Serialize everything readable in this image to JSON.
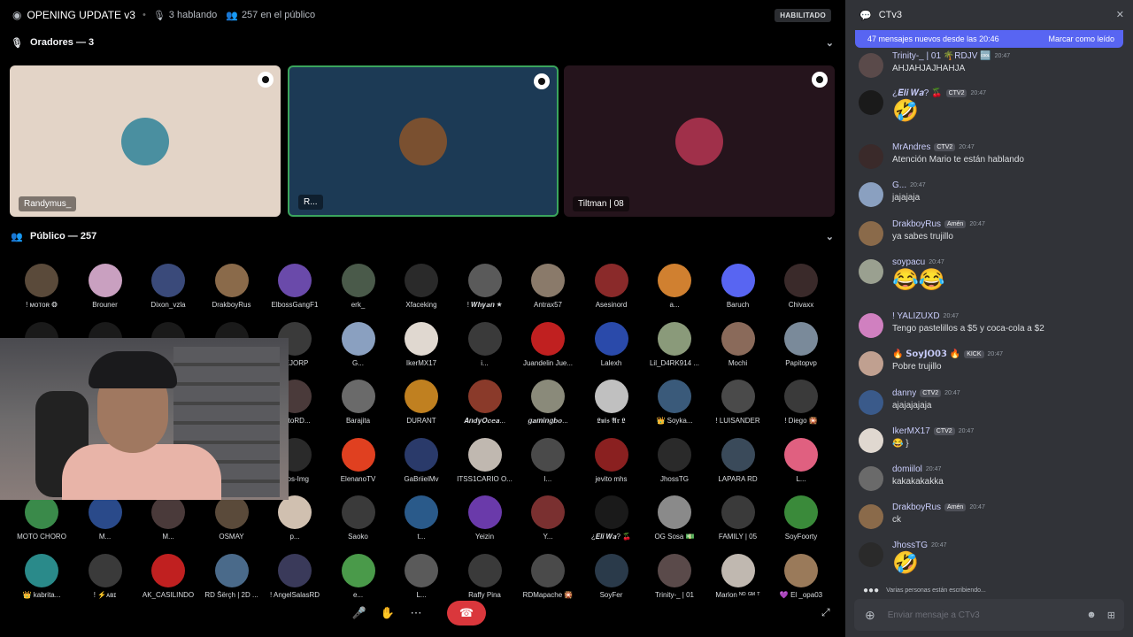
{
  "topbar": {
    "title": "OPENING UPDATE v3",
    "speaking": "3 hablando",
    "audience": "257 en el público",
    "badge": "HABILITADO"
  },
  "speakers_section": {
    "label": "Oradores — 3"
  },
  "speakers": [
    {
      "label": "Randymus_",
      "color": "#e3d4c7",
      "avatar": "#4a8fa0",
      "selected": false
    },
    {
      "label": "R...",
      "color": "#1c3a55",
      "avatar": "#7a5030",
      "selected": true
    },
    {
      "label": "Tiltman | 08",
      "color": "#25141c",
      "avatar": "#a0304a",
      "selected": false
    }
  ],
  "audience_section": {
    "label": "Público — 257"
  },
  "audience": [
    {
      "name": "! ᴍᴏᴛᴏʀ ❂",
      "color": "#5a4a3a"
    },
    {
      "name": "Brouner",
      "color": "#c9a0c0"
    },
    {
      "name": "Dixon_vzla",
      "color": "#3a4a7a"
    },
    {
      "name": "DrakboyRus",
      "color": "#8a6a4a"
    },
    {
      "name": "ElbossGangF1",
      "color": "#6a4aaa"
    },
    {
      "name": "erk_",
      "color": "#4a5a4a"
    },
    {
      "name": "Xfaceking",
      "color": "#2a2a2a"
    },
    {
      "name": "! 𝑾𝒉𝒚𝒂𝒏 ★",
      "color": "#5a5a5a"
    },
    {
      "name": "Antrax57",
      "color": "#8a7a6a"
    },
    {
      "name": "Asesinord",
      "color": "#8a2a2a"
    },
    {
      "name": "a...",
      "color": "#d08030"
    },
    {
      "name": "Baruch",
      "color": "#5865f2"
    },
    {
      "name": "Chivaxx",
      "color": "#3a2a2a"
    },
    {
      "name": "",
      "color": "#1a1a1a"
    },
    {
      "name": "",
      "color": "#1a1a1a"
    },
    {
      "name": "",
      "color": "#1a1a1a"
    },
    {
      "name": "",
      "color": "#1a1a1a"
    },
    {
      "name": "JEJORP",
      "color": "#3a3a3a"
    },
    {
      "name": "G...",
      "color": "#8aa0c0"
    },
    {
      "name": "IkerMX17",
      "color": "#e0d8d0"
    },
    {
      "name": "i...",
      "color": "#3a3a3a"
    },
    {
      "name": "Juandelin Jue...",
      "color": "#c02020"
    },
    {
      "name": "Lalexh",
      "color": "#2a4aaa"
    },
    {
      "name": "Lil_D4RK914 ...",
      "color": "#8a9a7a"
    },
    {
      "name": "Mochi",
      "color": "#8a6a5a"
    },
    {
      "name": "Papitopvp",
      "color": "#7a8a9a"
    },
    {
      "name": "",
      "color": "#1a1a1a"
    },
    {
      "name": "",
      "color": "#1a1a1a"
    },
    {
      "name": "",
      "color": "#1a1a1a"
    },
    {
      "name": "",
      "color": "#1a1a1a"
    },
    {
      "name": "RatoRD...",
      "color": "#4a3a3a"
    },
    {
      "name": "Barajita",
      "color": "#6a6a6a"
    },
    {
      "name": "DURANT",
      "color": "#c08020"
    },
    {
      "name": "𝑨𝒏𝒅𝒚𝑶𝒄𝒆𝒂...",
      "color": "#8a3a2a"
    },
    {
      "name": "𝒈𝒂𝒎𝒊𝒏𝒈𝒃𝒐...",
      "color": "#8a8a7a"
    },
    {
      "name": "𝕷𝖚𝖎𝖘 𝕬𝖗 𝕷",
      "color": "#c0c0c0"
    },
    {
      "name": "👑 Soyka...",
      "color": "#3a5a7a"
    },
    {
      "name": "! LUISANDER",
      "color": "#4a4a4a"
    },
    {
      "name": "! Diego 🎇",
      "color": "#3a3a3a"
    },
    {
      "name": "",
      "color": "#1a1a1a"
    },
    {
      "name": "",
      "color": "#1a1a1a"
    },
    {
      "name": "",
      "color": "#1a1a1a"
    },
    {
      "name": "",
      "color": "#1a1a1a"
    },
    {
      "name": "Rlos-Img",
      "color": "#2a2a2a"
    },
    {
      "name": "ElenanoTV",
      "color": "#e04020"
    },
    {
      "name": "GaBriielMv",
      "color": "#2a3a6a"
    },
    {
      "name": "ITSS1CARIO O...",
      "color": "#c0b8b0"
    },
    {
      "name": "l...",
      "color": "#4a4a4a"
    },
    {
      "name": "jevito mhs",
      "color": "#8a2020"
    },
    {
      "name": "JhossTG",
      "color": "#2a2a2a"
    },
    {
      "name": "LAPARA RD",
      "color": "#3a4a5a"
    },
    {
      "name": "L...",
      "color": "#e06080"
    },
    {
      "name": "MOTO CHORO",
      "color": "#3a8a4a"
    },
    {
      "name": "M...",
      "color": "#2a4a8a"
    },
    {
      "name": "M...",
      "color": "#4a3a3a"
    },
    {
      "name": "OSMAY",
      "color": "#5a4a3a"
    },
    {
      "name": "p...",
      "color": "#d0c0b0"
    },
    {
      "name": "Saoko",
      "color": "#3a3a3a"
    },
    {
      "name": "t...",
      "color": "#2a5a8a"
    },
    {
      "name": "Yeizin",
      "color": "#6a3aaa"
    },
    {
      "name": "Y...",
      "color": "#7a3030"
    },
    {
      "name": "¿𝑬𝒍𝒊 𝑾𝒂? 🍒",
      "color": "#1a1a1a"
    },
    {
      "name": "OG Sosa 💵",
      "color": "#8a8a8a"
    },
    {
      "name": "FAMILY | 05",
      "color": "#3a3a3a"
    },
    {
      "name": "SoyFoorty",
      "color": "#3a8a3a"
    },
    {
      "name": "👑 kabrita...",
      "color": "#2a8a8a"
    },
    {
      "name": "! ⚡ᴀʙɪ",
      "color": "#3a3a3a"
    },
    {
      "name": "AK_CASILINDO",
      "color": "#c02020"
    },
    {
      "name": "RD Šërçh | 2D ...",
      "color": "#4a6a8a"
    },
    {
      "name": "! AngelSalasRD",
      "color": "#3a3a5a"
    },
    {
      "name": "e...",
      "color": "#4a9a4a"
    },
    {
      "name": "L...",
      "color": "#5a5a5a"
    },
    {
      "name": "Raffy Pina",
      "color": "#3a3a3a"
    },
    {
      "name": "RDMapache 🎇",
      "color": "#4a4a4a"
    },
    {
      "name": "SoyFer",
      "color": "#2a3a4a"
    },
    {
      "name": "Trinity-_ | 01",
      "color": "#5a4a4a"
    },
    {
      "name": "Marlon ᴺᴼ ᴳᴹ ᵀ",
      "color": "#c0b8b0"
    },
    {
      "name": "💜 El _opa03",
      "color": "#9a7a5a"
    }
  ],
  "chat": {
    "channel": "CTv3",
    "banner_text": "47 mensajes nuevos desde las 20:46",
    "banner_action": "Marcar como leído",
    "messages": [
      {
        "name": "Trinity-_ | 01 🌴RDJV 🆒",
        "time": "20:47",
        "body": "AHJAHJAJHAHJA",
        "emoji": "",
        "avatar": "#5a4a4a"
      },
      {
        "name": "¿𝑬𝒍𝒊 𝑾𝒂? 🍒",
        "tag": "CTV2",
        "time": "20:47",
        "body": "",
        "emoji": "🤣",
        "avatar": "#1a1a1a"
      },
      {
        "name": "MrAndres",
        "tag": "CTV2",
        "time": "20:47",
        "body": "Atención Mario te están hablando",
        "emoji": "",
        "avatar": "#3a2a2a"
      },
      {
        "name": "G...",
        "time": "20:47",
        "body": "jajajaja",
        "emoji": "",
        "avatar": "#8aa0c0"
      },
      {
        "name": "DrakboyRus",
        "tag": "Amén",
        "time": "20:47",
        "body": "ya sabes trujillo",
        "emoji": "",
        "avatar": "#8a6a4a"
      },
      {
        "name": "soypacu",
        "time": "20:47",
        "body": "",
        "emoji": "😂😂",
        "avatar": "#9aa090"
      },
      {
        "name": "! YALIZUXD",
        "time": "20:47",
        "body": "Tengo pastelillos a $5 y coca-cola a $2",
        "emoji": "",
        "avatar": "#d080c0"
      },
      {
        "name": "🔥 𝗦𝗼𝘆𝗝𝗢𝟬𝟯 🔥",
        "tag": "KICK",
        "time": "20:47",
        "body": "Pobre trujillo",
        "emoji": "",
        "avatar": "#c0a090"
      },
      {
        "name": "danny",
        "tag": "CTV2",
        "time": "20:47",
        "body": "ajajajajaja",
        "emoji": "",
        "avatar": "#3a5a8a"
      },
      {
        "name": "IkerMX17",
        "tag": "CTV2",
        "time": "20:47",
        "body": "😂 }",
        "emoji": "",
        "avatar": "#e0d8d0"
      },
      {
        "name": "domiilol",
        "time": "20:47",
        "body": "kakakakakka",
        "emoji": "",
        "avatar": "#6a6a6a"
      },
      {
        "name": "DrakboyRus",
        "tag": "Amén",
        "time": "20:47",
        "body": "ck",
        "emoji": "",
        "avatar": "#8a6a4a"
      },
      {
        "name": "JhossTG",
        "time": "20:47",
        "body": "",
        "emoji": "🤣",
        "avatar": "#2a2a2a"
      }
    ],
    "typing": "Varias personas están escribiendo...",
    "composer_placeholder": "Enviar mensaje a CTv3"
  }
}
